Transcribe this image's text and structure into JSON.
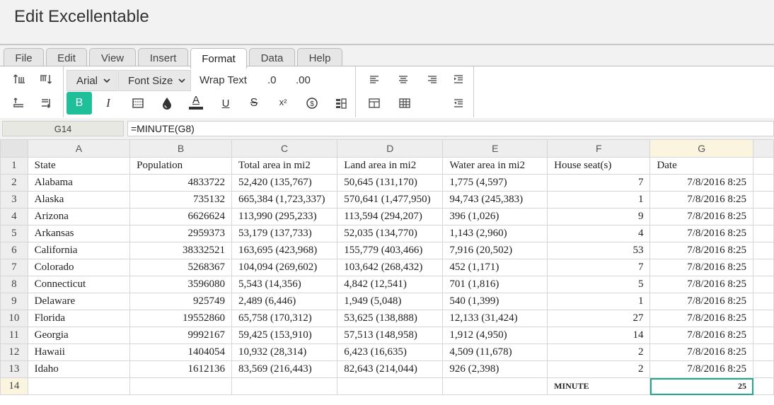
{
  "app": {
    "title": "Edit Excellentable"
  },
  "menu": [
    "File",
    "Edit",
    "View",
    "Insert",
    "Format",
    "Data",
    "Help"
  ],
  "active_menu": "Format",
  "toolbar": {
    "font_family": "Arial",
    "font_size": "Font Size",
    "wrap_text": "Wrap Text",
    "decrease_decimal": ".0",
    "increase_decimal": ".00",
    "bold": "B",
    "italic": "I",
    "font_color": "A",
    "underline": "U",
    "strikethrough": "S",
    "superscript": "x²",
    "accent_color": "#1fbf9a"
  },
  "formula_bar": {
    "cell_ref": "G14",
    "formula": "=MINUTE(G8)"
  },
  "sheet": {
    "columns": [
      "A",
      "B",
      "C",
      "D",
      "E",
      "F",
      "G"
    ],
    "selected_column": "G",
    "rows": [
      {
        "n": "1",
        "cells": [
          "State",
          "Population",
          "Total area in mi2",
          "Land area in mi2",
          "Water area in mi2",
          "House seat(s)",
          "Date"
        ]
      },
      {
        "n": "2",
        "cells": [
          "Alabama",
          "4833722",
          "52,420 (135,767)",
          "50,645 (131,170)",
          "1,775 (4,597)",
          "7",
          "7/8/2016 8:25"
        ]
      },
      {
        "n": "3",
        "cells": [
          "Alaska",
          "735132",
          "665,384 (1,723,337)",
          "570,641 (1,477,950)",
          "94,743 (245,383)",
          "1",
          "7/8/2016 8:25"
        ]
      },
      {
        "n": "4",
        "cells": [
          "Arizona",
          "6626624",
          "113,990 (295,233)",
          "113,594 (294,207)",
          "396 (1,026)",
          "9",
          "7/8/2016 8:25"
        ]
      },
      {
        "n": "5",
        "cells": [
          "Arkansas",
          "2959373",
          "53,179 (137,733)",
          "52,035 (134,770)",
          "1,143 (2,960)",
          "4",
          "7/8/2016 8:25"
        ]
      },
      {
        "n": "6",
        "cells": [
          "California",
          "38332521",
          "163,695 (423,968)",
          "155,779 (403,466)",
          "7,916 (20,502)",
          "53",
          "7/8/2016 8:25"
        ]
      },
      {
        "n": "7",
        "cells": [
          "Colorado",
          "5268367",
          "104,094 (269,602)",
          "103,642 (268,432)",
          "452 (1,171)",
          "7",
          "7/8/2016 8:25"
        ]
      },
      {
        "n": "8",
        "cells": [
          "Connecticut",
          "3596080",
          "5,543 (14,356)",
          "4,842 (12,541)",
          "701 (1,816)",
          "5",
          "7/8/2016 8:25"
        ]
      },
      {
        "n": "9",
        "cells": [
          "Delaware",
          "925749",
          "2,489 (6,446)",
          "1,949 (5,048)",
          "540 (1,399)",
          "1",
          "7/8/2016 8:25"
        ]
      },
      {
        "n": "10",
        "cells": [
          "Florida",
          "19552860",
          "65,758 (170,312)",
          "53,625 (138,888)",
          "12,133 (31,424)",
          "27",
          "7/8/2016 8:25"
        ]
      },
      {
        "n": "11",
        "cells": [
          "Georgia",
          "9992167",
          "59,425 (153,910)",
          "57,513 (148,958)",
          "1,912 (4,950)",
          "14",
          "7/8/2016 8:25"
        ]
      },
      {
        "n": "12",
        "cells": [
          "Hawaii",
          "1404054",
          "10,932 (28,314)",
          "6,423 (16,635)",
          "4,509 (11,678)",
          "2",
          "7/8/2016 8:25"
        ]
      },
      {
        "n": "13",
        "cells": [
          "Idaho",
          "1612136",
          "83,569 (216,443)",
          "82,643 (214,044)",
          "926 (2,398)",
          "2",
          "7/8/2016 8:25"
        ]
      },
      {
        "n": "14",
        "cells": [
          "",
          "",
          "",
          "",
          "",
          "MINUTE",
          "25"
        ]
      }
    ]
  }
}
